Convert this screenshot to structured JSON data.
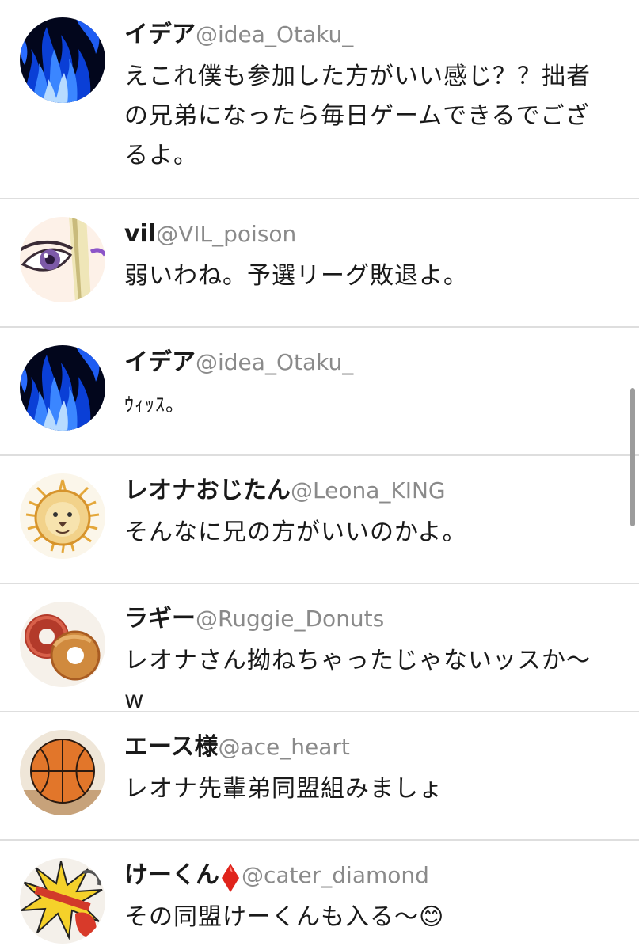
{
  "posts": [
    {
      "name": "イデア",
      "handle": "@idea_Otaku_",
      "text": "えこれ僕も参加した方がいい感じ？？拙者の兄弟になったら毎日ゲームできるでござるよ。",
      "avatar": "blue-flame-avatar"
    },
    {
      "name": "vil",
      "handle": "@VIL_poison",
      "text": "弱いわね。予選リーグ敗退よ。",
      "avatar": "purple-eye-avatar"
    },
    {
      "name": "イデア",
      "handle": "@idea_Otaku_",
      "text": "ｳｨｯｽ。",
      "avatar": "blue-flame-avatar"
    },
    {
      "name": "レオナおじたん",
      "handle": "@Leona_KING",
      "text": "そんなに兄の方がいいのかよ。",
      "avatar": "lion-drawing-avatar"
    },
    {
      "name": "ラギー",
      "handle": "@Ruggie_Donuts",
      "text": "レオナさん拗ねちゃったじゃないッスか〜w",
      "avatar": "donuts-avatar"
    },
    {
      "name": "エース様",
      "handle": "@ace_heart",
      "text": "レオナ先輩弟同盟組みましょ",
      "avatar": "basketball-avatar"
    },
    {
      "name": "けーくん",
      "handle": "@cater_diamond",
      "text": "その同盟けーくんも入る〜😊",
      "avatar": "comic-avatar",
      "name_icon": "red-diamond-icon"
    }
  ],
  "colors": {
    "name": "#1a1a1a",
    "handle": "#8a8a8a",
    "divider": "#dedede",
    "diamond": "#e0241c",
    "scrollbar": "#9c9c9c"
  }
}
